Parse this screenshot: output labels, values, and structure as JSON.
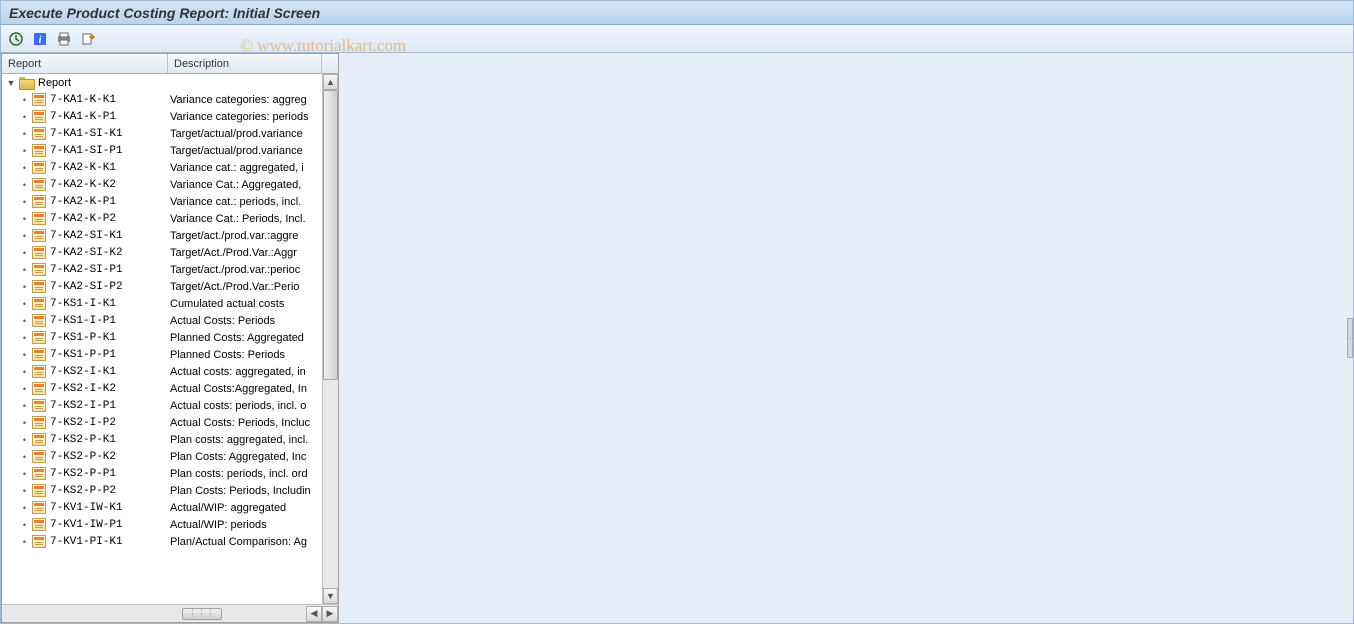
{
  "title": "Execute Product Costing Report: Initial Screen",
  "watermark": "© www.tutorialkart.com",
  "toolbar": {
    "execute": "execute",
    "info": "info",
    "print": "print",
    "export": "export"
  },
  "tree": {
    "header_report": "Report",
    "header_description": "Description",
    "root_label": "Report",
    "rows": [
      {
        "code": "7-KA1-K-K1",
        "desc": "Variance categories: aggreg"
      },
      {
        "code": "7-KA1-K-P1",
        "desc": "Variance categories: periods"
      },
      {
        "code": "7-KA1-SI-K1",
        "desc": "Target/actual/prod.variance"
      },
      {
        "code": "7-KA1-SI-P1",
        "desc": "Target/actual/prod.variance"
      },
      {
        "code": "7-KA2-K-K1",
        "desc": "Variance cat.: aggregated, i"
      },
      {
        "code": "7-KA2-K-K2",
        "desc": "Variance Cat.: Aggregated,"
      },
      {
        "code": "7-KA2-K-P1",
        "desc": "Variance cat.: periods, incl."
      },
      {
        "code": "7-KA2-K-P2",
        "desc": "Variance Cat.: Periods, Incl."
      },
      {
        "code": "7-KA2-SI-K1",
        "desc": "Target/act./prod.var.:aggre"
      },
      {
        "code": "7-KA2-SI-K2",
        "desc": "Target/Act./Prod.Var.:Aggr"
      },
      {
        "code": "7-KA2-SI-P1",
        "desc": "Target/act./prod.var.:perioc"
      },
      {
        "code": "7-KA2-SI-P2",
        "desc": "Target/Act./Prod.Var.:Perio"
      },
      {
        "code": "7-KS1-I-K1",
        "desc": "Cumulated actual costs"
      },
      {
        "code": "7-KS1-I-P1",
        "desc": "Actual Costs: Periods"
      },
      {
        "code": "7-KS1-P-K1",
        "desc": "Planned Costs: Aggregated"
      },
      {
        "code": "7-KS1-P-P1",
        "desc": "Planned Costs: Periods"
      },
      {
        "code": "7-KS2-I-K1",
        "desc": "Actual costs: aggregated, in"
      },
      {
        "code": "7-KS2-I-K2",
        "desc": "Actual Costs:Aggregated, In"
      },
      {
        "code": "7-KS2-I-P1",
        "desc": "Actual costs: periods, incl. o"
      },
      {
        "code": "7-KS2-I-P2",
        "desc": "Actual Costs: Periods, Incluc"
      },
      {
        "code": "7-KS2-P-K1",
        "desc": "Plan costs: aggregated, incl."
      },
      {
        "code": "7-KS2-P-K2",
        "desc": "Plan Costs: Aggregated, Inc"
      },
      {
        "code": "7-KS2-P-P1",
        "desc": "Plan costs: periods, incl. ord"
      },
      {
        "code": "7-KS2-P-P2",
        "desc": "Plan Costs: Periods, Includin"
      },
      {
        "code": "7-KV1-IW-K1",
        "desc": "Actual/WIP: aggregated"
      },
      {
        "code": "7-KV1-IW-P1",
        "desc": "Actual/WIP: periods"
      },
      {
        "code": "7-KV1-PI-K1",
        "desc": "Plan/Actual Comparison: Ag"
      }
    ]
  }
}
